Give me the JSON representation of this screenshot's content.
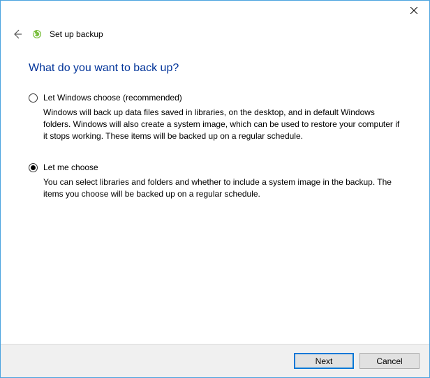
{
  "window": {
    "title": "Set up backup"
  },
  "heading": "What do you want to back up?",
  "options": [
    {
      "label": "Let Windows choose (recommended)",
      "description": "Windows will back up data files saved in libraries, on the desktop, and in default Windows folders. Windows will also create a system image, which can be used to restore your computer if it stops working. These items will be backed up on a regular schedule.",
      "selected": false
    },
    {
      "label": "Let me choose",
      "description": "You can select libraries and folders and whether to include a system image in the backup. The items you choose will be backed up on a regular schedule.",
      "selected": true
    }
  ],
  "buttons": {
    "next": "Next",
    "cancel": "Cancel"
  }
}
